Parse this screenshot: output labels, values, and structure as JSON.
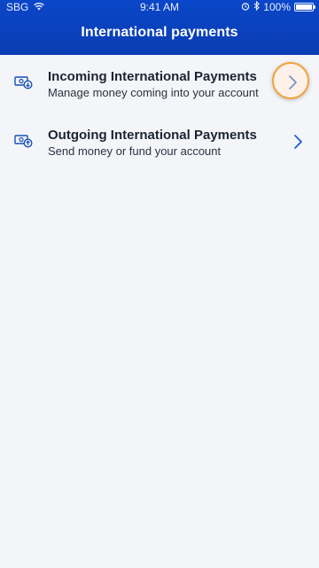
{
  "status_bar": {
    "carrier": "SBG",
    "time": "9:41 AM",
    "battery_text": "100%",
    "battery_level": 1.0,
    "icons": [
      "wifi-icon",
      "alarm-icon",
      "bluetooth-icon",
      "battery-icon"
    ]
  },
  "header": {
    "title": "International payments",
    "background_color": "#0b42c2"
  },
  "items": [
    {
      "icon": "money-transfer-icon",
      "title": "Incoming International Payments",
      "subtitle": "Manage money coming into your account",
      "chevron": "chevron-right-icon",
      "highlighted": true
    },
    {
      "icon": "money-transfer-icon",
      "title": "Outgoing International Payments",
      "subtitle": "Send money or fund your account",
      "chevron": "chevron-right-icon",
      "highlighted": false
    }
  ],
  "colors": {
    "accent": "#1a5fd6",
    "highlight_ring": "#f2a23b",
    "background": "#f3f5f9",
    "text_primary": "#1c2431"
  }
}
